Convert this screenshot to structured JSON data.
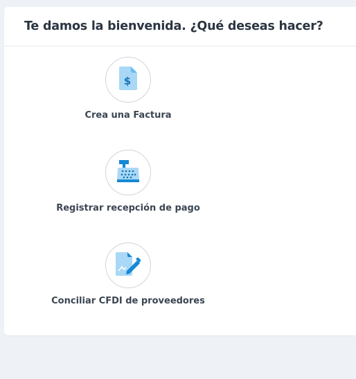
{
  "header": {
    "title": "Te damos la bienvenida. ¿Qué deseas hacer?"
  },
  "actions": [
    {
      "label": "Crea una Factura",
      "icon": "invoice-dollar-icon"
    },
    {
      "label": "Registrar recepción de pago",
      "icon": "cash-register-icon"
    },
    {
      "label": "Conciliar CFDI de proveedores",
      "icon": "document-edit-icon"
    }
  ],
  "colors": {
    "background": "#eef2f6",
    "card": "#ffffff",
    "title": "#2b3542",
    "label": "#3b4552",
    "icon_light": "#a9d8f6",
    "icon_dark": "#1688d4"
  }
}
